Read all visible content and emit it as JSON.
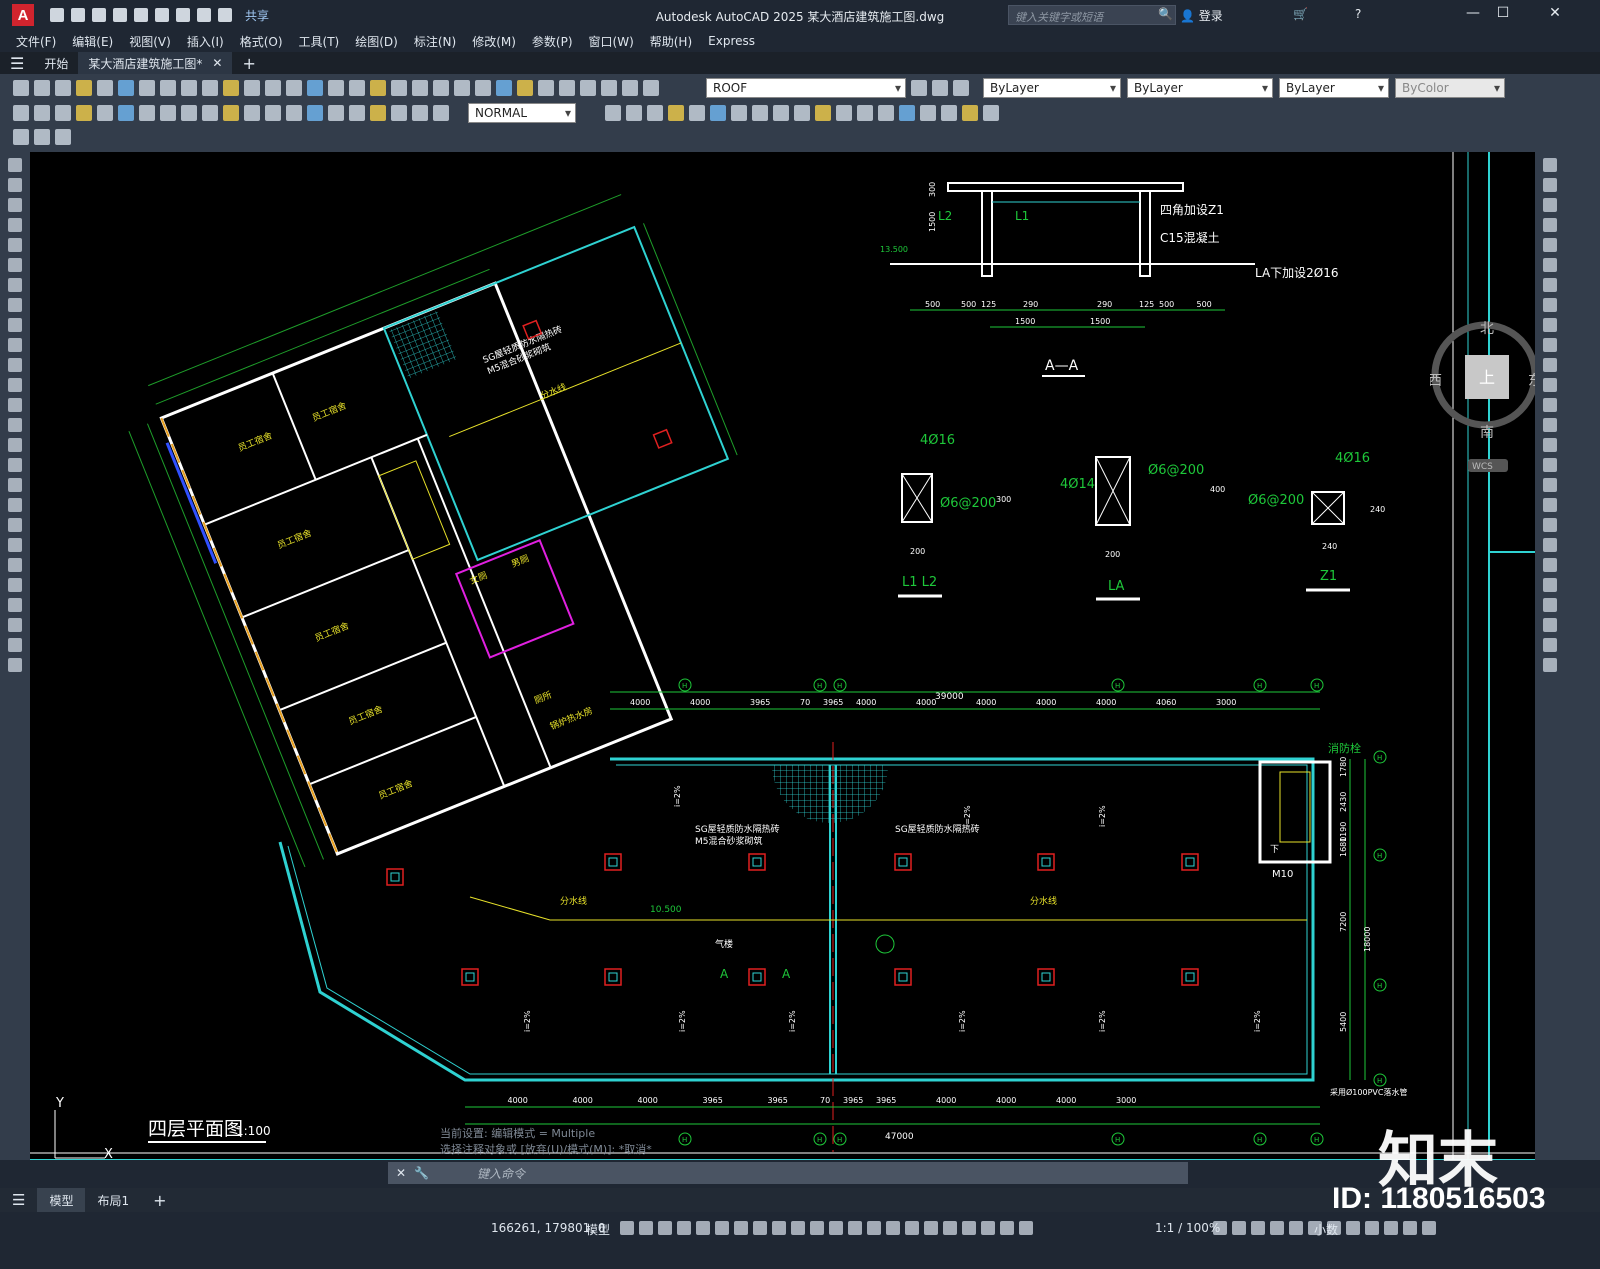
{
  "titlebar": {
    "share": "共享",
    "title": "Autodesk AutoCAD 2025    某大酒店建筑施工图.dwg",
    "search_placeholder": "键入关键字或短语",
    "login": "登录"
  },
  "menu": [
    "文件(F)",
    "编辑(E)",
    "视图(V)",
    "插入(I)",
    "格式(O)",
    "工具(T)",
    "绘图(D)",
    "标注(N)",
    "修改(M)",
    "参数(P)",
    "窗口(W)",
    "帮助(H)",
    "Express"
  ],
  "tabs": {
    "start": "开始",
    "file": "某大酒店建筑施工图*",
    "add": "+"
  },
  "ribbon": {
    "layer": "ROOF",
    "color": "ByLayer",
    "linetype": "ByLayer",
    "lineweight": "ByLayer",
    "plotstyle": "ByColor",
    "dimstyle": "NORMAL"
  },
  "drawing": {
    "plan_title": "四层平面图",
    "plan_scale": "1:100",
    "section_aa": "A—A",
    "sec_L2": "L2",
    "sec_L1": "L1",
    "sec_z1": "四角加设Z1",
    "sec_c15": "C15混凝土",
    "sec_la": "LA下加设2Ø16",
    "sec_elev": "13.500",
    "sec_dims": [
      "500",
      "500",
      "125",
      "290",
      "290",
      "125",
      "500",
      "500"
    ],
    "sec_dims2": [
      "1500",
      "1500"
    ],
    "sec_v": [
      "300",
      "1500"
    ],
    "l1l2_label": "L1 L2",
    "l1l2_top": "4Ø16",
    "l1l2_stir": "Ø6@200",
    "l1l2_w": "200",
    "l1l2_h": "300",
    "la_label": "LA",
    "la_top": "4Ø14",
    "la_stir": "Ø6@200",
    "la_w": "200",
    "la_h": "400",
    "z1_label": "Z1",
    "z1_top": "4Ø16",
    "z1_stir": "Ø6@200",
    "z1_w": "240",
    "z1_h": "240",
    "fire": "消防栓",
    "stair_m10": "M10",
    "stair_down": "下",
    "dims_top": [
      "4000",
      "4000",
      "3965",
      "70",
      "3965",
      "4000",
      "4000",
      "4000",
      "4000",
      "4000",
      "4060",
      "3000"
    ],
    "total_top": "39000",
    "dims_bot": [
      "4000",
      "4000",
      "4000",
      "3965",
      "3965",
      "70",
      "3965",
      "3965",
      "4000",
      "4000",
      "4000",
      "3000"
    ],
    "total_bot": "47000",
    "room_labels": [
      "员工宿舍",
      "员工宿舍",
      "员工宿舍",
      "员工宿舍",
      "员工宿舍",
      "员工宿舍",
      "锅炉热水房",
      "厕所",
      "女厕",
      "男厕"
    ],
    "roof_notes": [
      "SG屋轻质防水隔热砖",
      "M5混合砂浆砌筑"
    ],
    "slope": "i=2%",
    "fen_shui": "分水线",
    "elev_105": "10.500",
    "pipe": "采用Ø100PVC落水管",
    "qi_lou": "气楼",
    "sec_mark": "A",
    "right_dims": [
      "1780",
      "2430",
      "1190",
      "1680",
      "7200",
      "5400",
      "18000"
    ],
    "axis_h": "H"
  },
  "viewcube": {
    "n": "北",
    "s": "南",
    "e": "东",
    "w": "西",
    "top": "上",
    "wcs": "WCS"
  },
  "cmd": {
    "history1": "当前设置: 编辑模式 = Multiple",
    "history2": "选择注释对象或 [放弃(U)/模式(M)]: *取消*",
    "input": "键入命令"
  },
  "layouts": [
    "模型",
    "布局1",
    "+"
  ],
  "status": {
    "coords": "166261, 179801, 0",
    "model": "模型",
    "scale": "1:1 / 100%",
    "units": "小数"
  },
  "watermark": "知末",
  "id": "ID: 1180516503"
}
